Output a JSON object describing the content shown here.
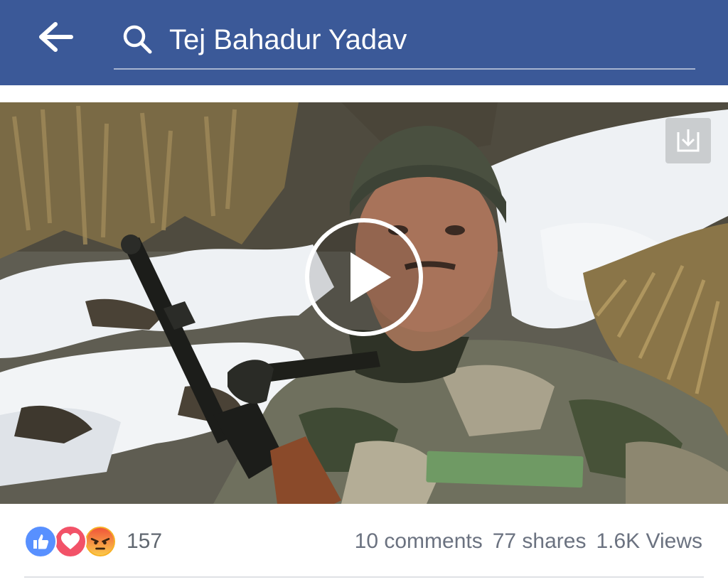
{
  "header": {
    "back_icon": "arrow-left-icon",
    "search_icon": "search-icon",
    "search_query": "Tej Bahadur Yadav",
    "bar_color": "#3b5998"
  },
  "video": {
    "play_icon": "play-circle-icon",
    "download_icon": "download-icon"
  },
  "reactions": {
    "types": [
      "like",
      "love",
      "angry"
    ],
    "count": "157"
  },
  "stats": {
    "comments": "10 comments",
    "shares": "77 shares",
    "views": "1.6K Views"
  }
}
